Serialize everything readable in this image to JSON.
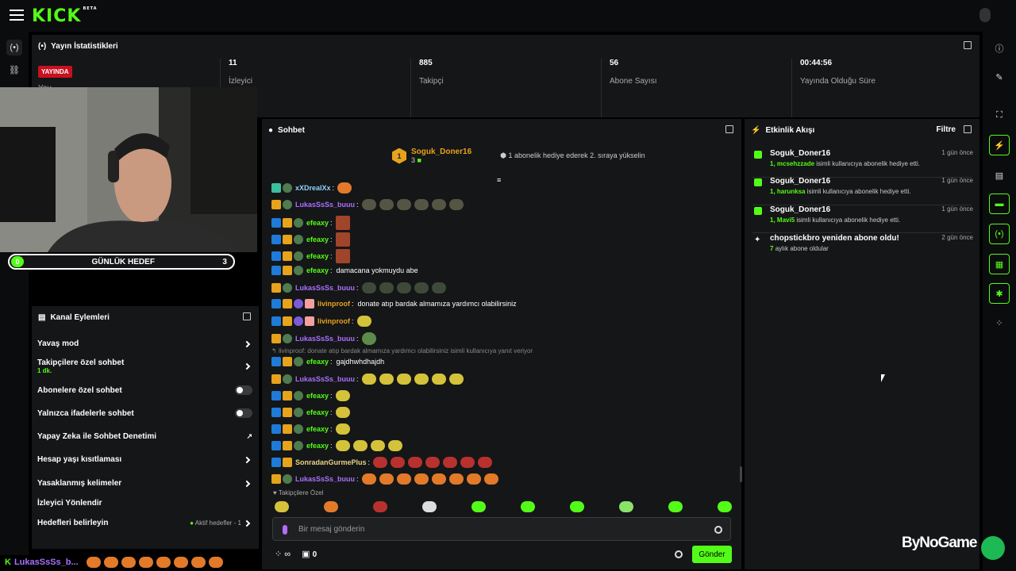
{
  "app": {
    "logo": "KICK",
    "logo_badge": "BETA"
  },
  "stats_panel": {
    "title": "Yayın İstatistikleri",
    "live_badge": "YAYINDA",
    "live_sub": "Yay",
    "items": [
      {
        "value": "11",
        "label": "İzleyici"
      },
      {
        "value": "885",
        "label": "Takipçi"
      },
      {
        "value": "56",
        "label": "Abone Sayısı"
      },
      {
        "value": "00:44:56",
        "label": "Yayında Olduğu Süre"
      }
    ]
  },
  "goal": {
    "start": "0",
    "label": "GÜNLÜK HEDEF",
    "end": "3"
  },
  "channel_actions": {
    "title": "Kanal Eylemleri",
    "rows": [
      {
        "label": "Yavaş mod"
      },
      {
        "label": "Takipçilere özel sohbet",
        "sub": "1 dk."
      },
      {
        "label": "Abonelere özel sohbet"
      },
      {
        "label": "Yalnızca ifadelerle sohbet"
      },
      {
        "label": "Yapay Zeka ile Sohbet Denetimi"
      },
      {
        "label": "Hesap yaşı kısıtlaması"
      },
      {
        "label": "Yasaklanmış kelimeler"
      },
      {
        "label": "İzleyici Yönlendir"
      },
      {
        "label": "Hedefleri belirleyin",
        "status": "Aktif hedefler - 1"
      }
    ]
  },
  "chat": {
    "title": "Sohbet",
    "pinned": {
      "rank": "1",
      "user": "Soguk_Doner16",
      "count": "3",
      "text": "1 abonelik hediye ederek 2. sıraya yükselin"
    },
    "messages": [
      {
        "user": "xXDrealXx",
        "color": "#8fd3ff",
        "text": ""
      },
      {
        "user": "LukasSsSs_buuu",
        "color": "#a970ff",
        "text": ""
      },
      {
        "user": "efeaxy",
        "color": "#53fc18",
        "text": ""
      },
      {
        "user": "efeaxy",
        "color": "#53fc18",
        "text": ""
      },
      {
        "user": "efeaxy",
        "color": "#53fc18",
        "text": ""
      },
      {
        "user": "efeaxy",
        "color": "#53fc18",
        "text": "damacana yokmuydu abe"
      },
      {
        "user": "LukasSsSs_buuu",
        "color": "#a970ff",
        "text": ""
      },
      {
        "user": "livinproof",
        "color": "#e6a31b",
        "text": "donate atıp bardak almamıza yardımcı olabilirsiniz"
      },
      {
        "user": "livinproof",
        "color": "#e6a31b",
        "text": ""
      },
      {
        "user": "LukasSsSs_buuu",
        "color": "#a970ff",
        "text": ""
      },
      {
        "user": "efeaxy",
        "color": "#53fc18",
        "text": "gajdhwhdhajdh"
      },
      {
        "user": "LukasSsSs_buuu",
        "color": "#a970ff",
        "text": ""
      },
      {
        "user": "efeaxy",
        "color": "#53fc18",
        "text": ""
      },
      {
        "user": "efeaxy",
        "color": "#53fc18",
        "text": ""
      },
      {
        "user": "efeaxy",
        "color": "#53fc18",
        "text": ""
      },
      {
        "user": "efeaxy",
        "color": "#53fc18",
        "text": ""
      },
      {
        "user": "SonradanGurmePlus",
        "color": "#e6d38a",
        "text": ""
      },
      {
        "user": "LukasSsSs_buuu",
        "color": "#a970ff",
        "text": ""
      }
    ],
    "reply_note": "livinproof: donate atıp bardak almamıza yardımcı olabilirsiniz isimli kullanıcıya yanıt veriyor",
    "emote_label": "Takipçilere Özel",
    "input_placeholder": "Bir mesaj gönderin",
    "points": "∞",
    "gift_count": "0",
    "send": "Gönder"
  },
  "feed": {
    "title": "Etkinlik Akışı",
    "filter": "Filtre",
    "events": [
      {
        "user": "Soguk_Doner16",
        "time": "1 gün önce",
        "detail_num": "1,",
        "detail_user": "mcsehzzade",
        "detail": "isimli kullanıcıya abonelik hediye etti."
      },
      {
        "user": "Soguk_Doner16",
        "time": "1 gün önce",
        "detail_num": "1,",
        "detail_user": "harunksa",
        "detail": "isimli kullanıcıya abonelik hediye etti."
      },
      {
        "user": "Soguk_Doner16",
        "time": "1 gün önce",
        "detail_num": "1,",
        "detail_user": "Mavi5",
        "detail": "isimli kullanıcıya abonelik hediye etti."
      },
      {
        "user": "chopstickbro yeniden abone oldu!",
        "time": "2 gün önce",
        "detail_num": "7",
        "detail_user": "",
        "detail": "aylık abone oldular"
      }
    ]
  },
  "bottom": {
    "user": "LukasSsSs_b..."
  },
  "watermark": "ByNoGame"
}
